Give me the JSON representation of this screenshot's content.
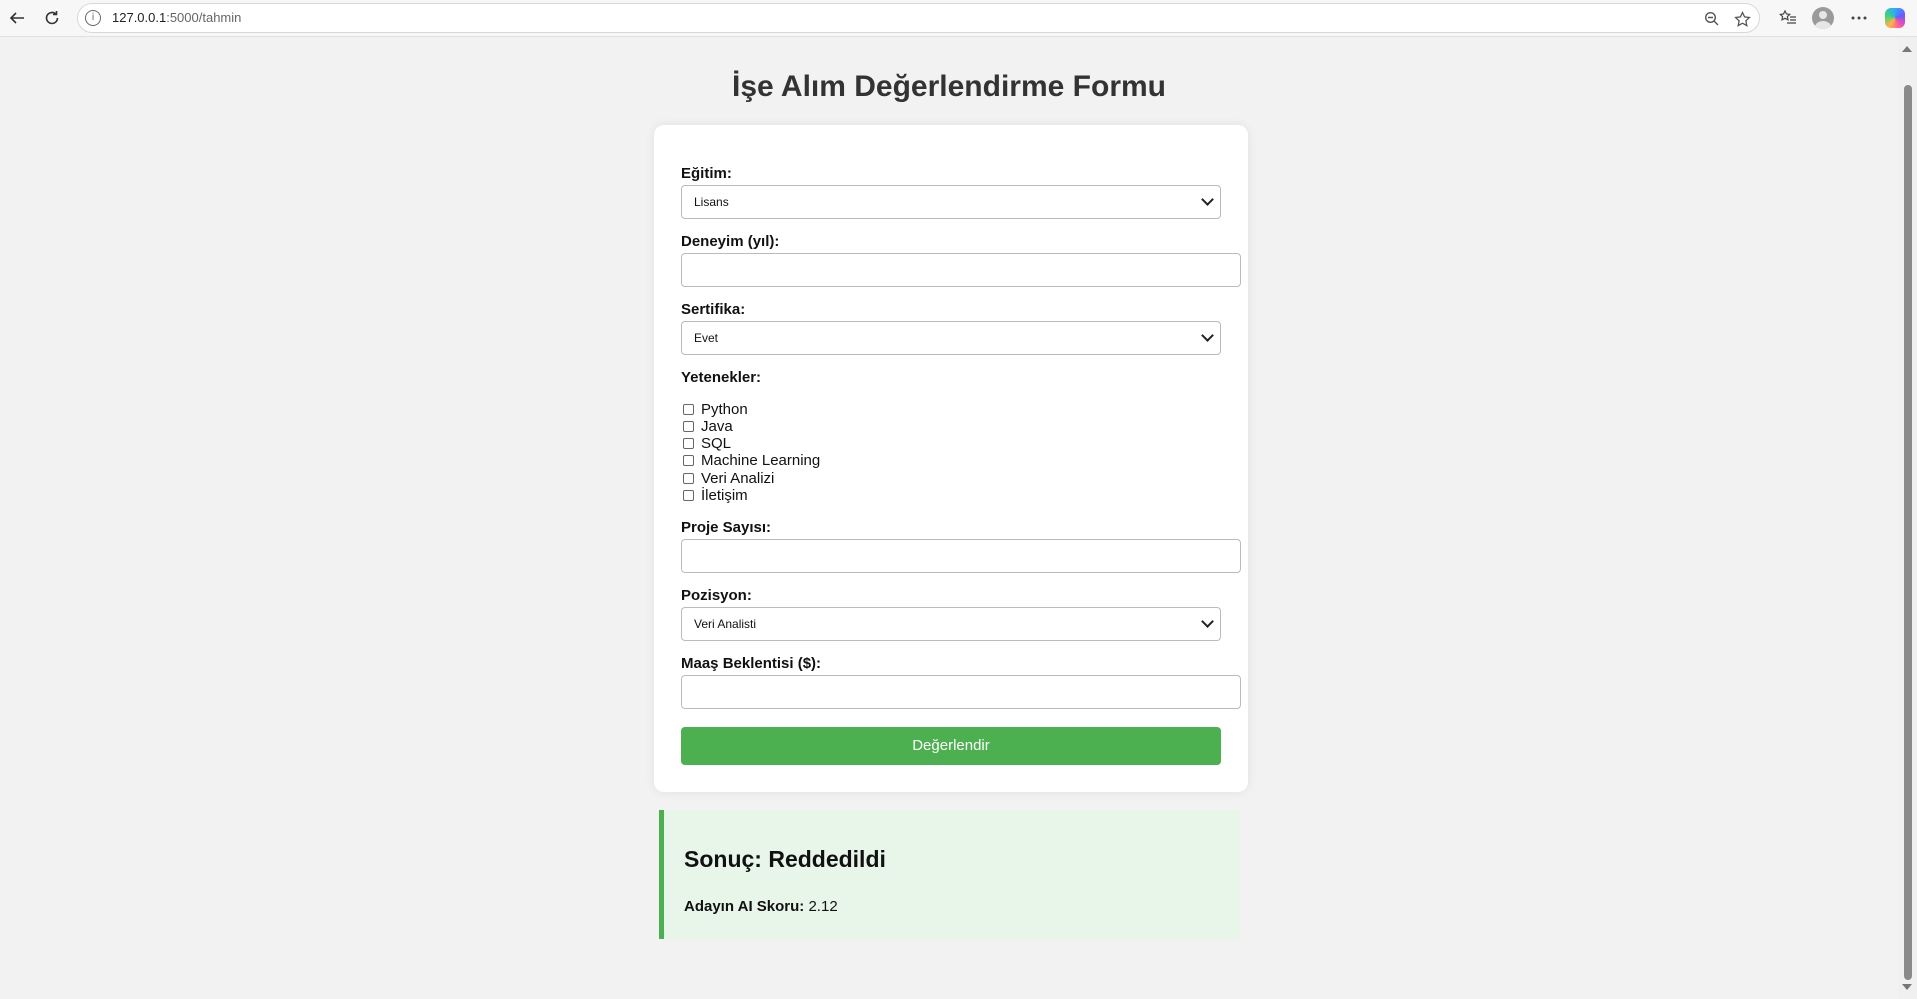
{
  "browser": {
    "url_host": "127.0.0.1",
    "url_rest": ":5000/tahmin",
    "info_icon": "i"
  },
  "page": {
    "title": "İşe Alım Değerlendirme Formu"
  },
  "form": {
    "education": {
      "label": "Eğitim:",
      "value": "Lisans"
    },
    "experience": {
      "label": "Deneyim (yıl):",
      "value": ""
    },
    "certificate": {
      "label": "Sertifika:",
      "value": "Evet"
    },
    "skills": {
      "label": "Yetenekler:",
      "options": [
        "Python",
        "Java",
        "SQL",
        "Machine Learning",
        "Veri Analizi",
        "İletişim"
      ]
    },
    "projects": {
      "label": "Proje Sayısı:",
      "value": ""
    },
    "position": {
      "label": "Pozisyon:",
      "value": "Veri Analisti"
    },
    "salary": {
      "label": "Maaş Beklentisi ($):",
      "value": ""
    },
    "submit_label": "Değerlendir"
  },
  "result": {
    "title": "Sonuç: Reddedildi",
    "score_label": "Adayın AI Skoru:",
    "score_value": "2.12",
    "accent_color": "#4caf50",
    "background_color": "#e8f5e9"
  }
}
